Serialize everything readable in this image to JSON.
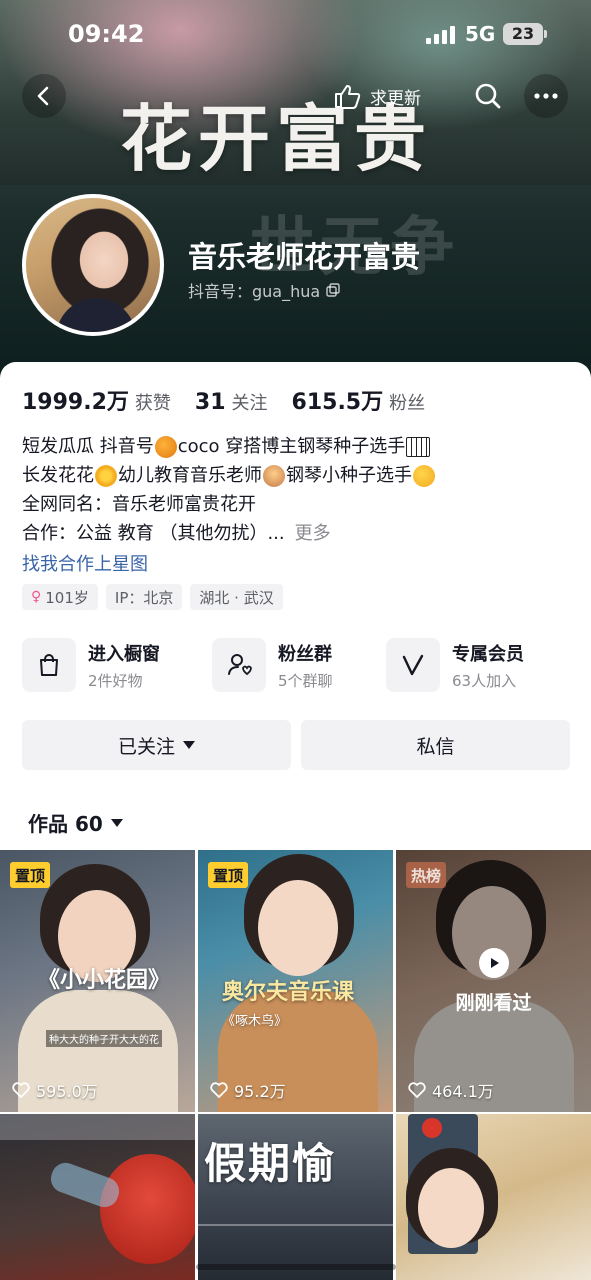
{
  "status_bar": {
    "time": "09:42",
    "network": "5G",
    "battery": "23"
  },
  "banner": {
    "title": "花开富贵",
    "subtitle": "世无争"
  },
  "nav": {
    "update_label": "求更新"
  },
  "profile": {
    "nickname": "音乐老师花开富贵",
    "douyin_id": "抖音号：gua_hua"
  },
  "stats": [
    {
      "value": "1999.2万",
      "label": "获赞"
    },
    {
      "value": "31",
      "label": "关注"
    },
    {
      "value": "615.5万",
      "label": "粉丝"
    }
  ],
  "bio": {
    "line1_a": "短发瓜瓜 抖音号",
    "line1_b": "coco 穿搭博主钢琴种子选手",
    "line2_a": "长发花花",
    "line2_b": "幼儿教育音乐老师",
    "line2_c": "钢琴小种子选手",
    "line3": "全网同名：音乐老师富贵花开",
    "line4": "合作：公益 教育 （其他勿扰）...",
    "more": "更多",
    "partner_link": "找我合作上星图"
  },
  "tags": [
    "101岁",
    "IP：北京",
    "湖北 · 武汉"
  ],
  "shortcuts": [
    {
      "title": "进入橱窗",
      "sub": "2件好物",
      "icon": "shopping-bag-icon"
    },
    {
      "title": "粉丝群",
      "sub": "5个群聊",
      "icon": "fan-group-icon"
    },
    {
      "title": "专属会员",
      "sub": "63人加入",
      "icon": "member-v-icon"
    }
  ],
  "actions": {
    "follow": "已关注",
    "message": "私信"
  },
  "works": {
    "label": "作品 60"
  },
  "videos": [
    {
      "badge": "置顶",
      "likes": "595.0万",
      "overlay": "《小小花园》",
      "caption": "种大大的种子开大大的花"
    },
    {
      "badge": "置顶",
      "likes": "95.2万",
      "overlay": "奥尔夫音乐课",
      "caption2": "《啄木鸟》"
    },
    {
      "badge": "热榜",
      "likes": "464.1万",
      "watched": "刚刚看过"
    },
    {
      "overlay": "假期愉"
    },
    {},
    {}
  ],
  "colors": {
    "accent_link": "#3a64a8",
    "pin_badge": "#ffce2e",
    "text_primary": "#161823",
    "text_secondary": "#8a8b91"
  }
}
